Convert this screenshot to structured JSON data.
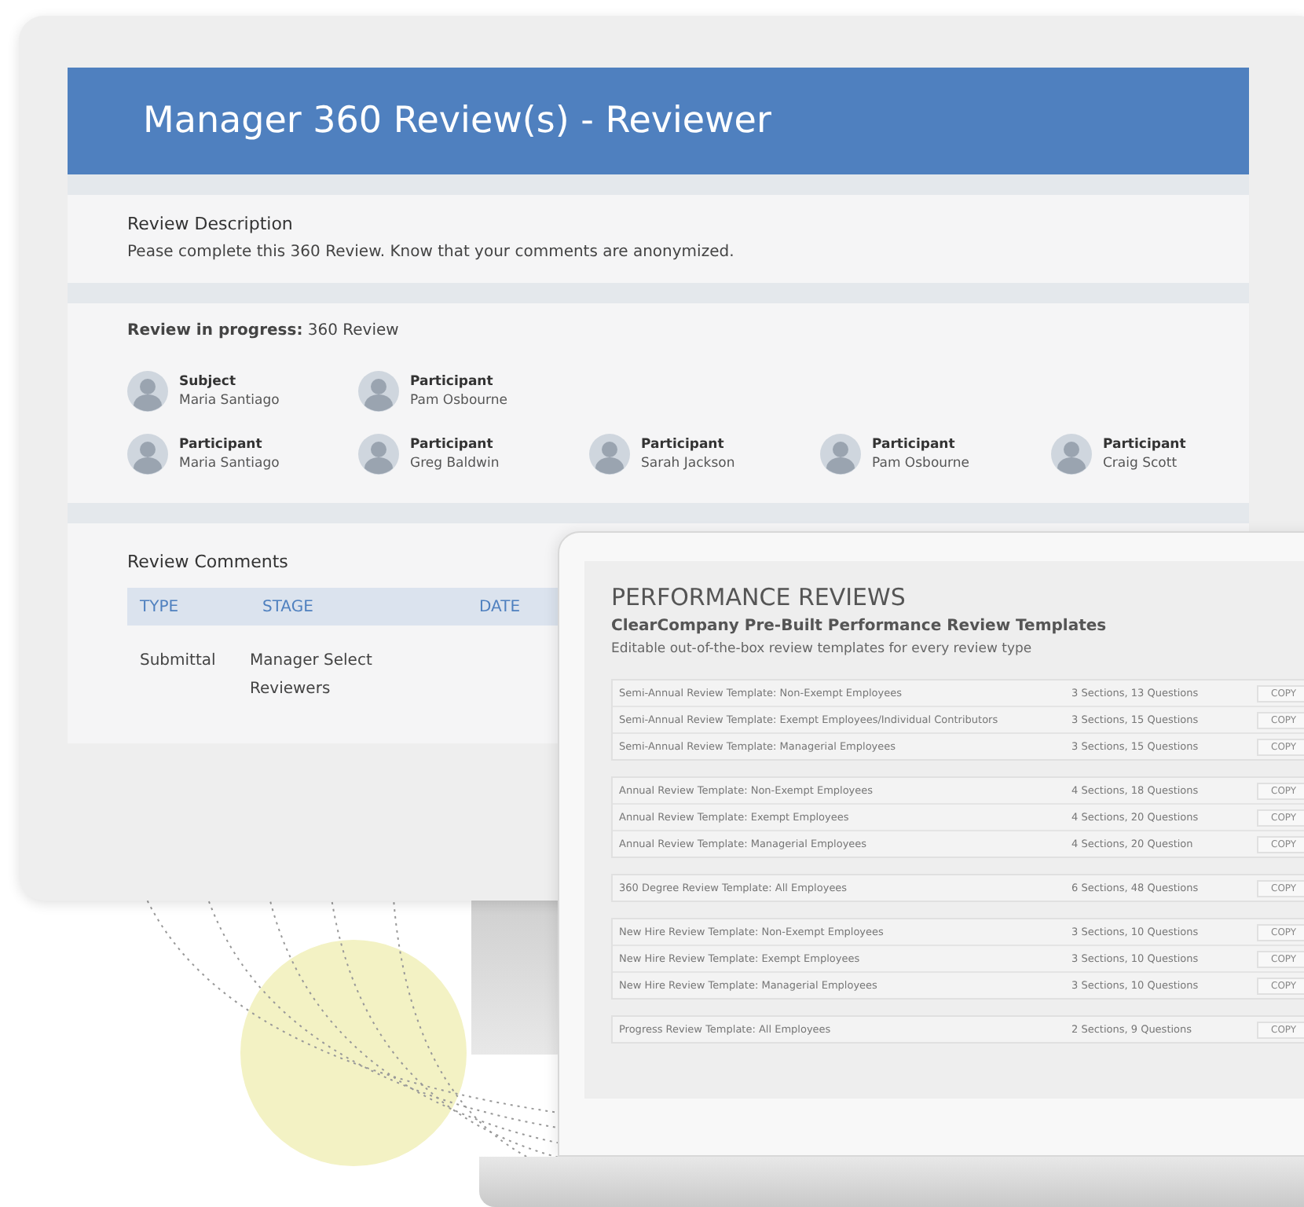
{
  "monitor": {
    "title": "Manager 360 Review(s) - Reviewer",
    "description": {
      "heading": "Review Description",
      "text": "Pease complete this 360 Review. Know that your comments are anonymized."
    },
    "progress": {
      "label": "Review in progress:",
      "value": "360 Review",
      "participant_rows": [
        [
          {
            "role": "Subject",
            "name": "Maria Santiago"
          },
          {
            "role": "Participant",
            "name": "Pam Osbourne"
          }
        ],
        [
          {
            "role": "Participant",
            "name": "Maria Santiago"
          },
          {
            "role": "Participant",
            "name": "Greg Baldwin"
          },
          {
            "role": "Participant",
            "name": "Sarah Jackson"
          },
          {
            "role": "Participant",
            "name": "Pam Osbourne"
          },
          {
            "role": "Participant",
            "name": "Craig Scott"
          }
        ]
      ]
    },
    "comments": {
      "heading": "Review Comments",
      "columns": [
        "TYPE",
        "STAGE",
        "DATE"
      ],
      "rows": [
        [
          "Submittal",
          "Manager Select Reviewers"
        ]
      ]
    }
  },
  "laptop": {
    "title": "PERFORMANCE REVIEWS",
    "subtitle": "ClearCompany Pre-Built Performance Review Templates",
    "tagline": "Editable out-of-the-box review templates for every review type",
    "groups": [
      [
        {
          "name": "Semi-Annual Review Template: Non-Exempt Employees",
          "info": "3 Sections, 13 Questions",
          "action": "COPY"
        },
        {
          "name": "Semi-Annual Review Template: Exempt Employees/Individual Contributors",
          "info": "3 Sections, 15 Questions",
          "action": "COPY"
        },
        {
          "name": "Semi-Annual Review Template: Managerial Employees",
          "info": "3 Sections, 15 Questions",
          "action": "COPY"
        }
      ],
      [
        {
          "name": "Annual Review Template: Non-Exempt Employees",
          "info": "4 Sections, 18 Questions",
          "action": "COPY"
        },
        {
          "name": "Annual Review Template: Exempt Employees",
          "info": "4 Sections, 20 Questions",
          "action": "COPY"
        },
        {
          "name": "Annual Review Template: Managerial Employees",
          "info": "4 Sections, 20 Question",
          "action": "COPY"
        }
      ],
      [
        {
          "name": "360 Degree Review Template: All Employees",
          "info": "6 Sections, 48 Questions",
          "action": "COPY"
        }
      ],
      [
        {
          "name": "New Hire Review Template: Non-Exempt Employees",
          "info": "3 Sections, 10 Questions",
          "action": "COPY"
        },
        {
          "name": "New Hire Review Template: Exempt Employees",
          "info": "3 Sections, 10 Questions",
          "action": "COPY"
        },
        {
          "name": "New Hire Review Template: Managerial Employees",
          "info": "3 Sections, 10 Questions",
          "action": "COPY"
        }
      ],
      [
        {
          "name": "Progress Review Template: All Employees",
          "info": "2 Sections, 9 Questions",
          "action": "COPY"
        }
      ]
    ]
  }
}
